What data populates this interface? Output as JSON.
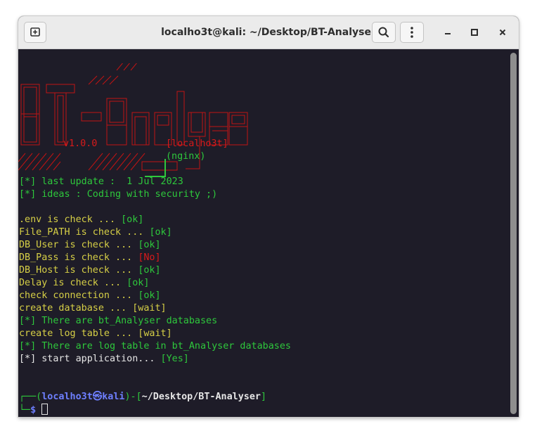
{
  "window": {
    "title": "localho3t@kali: ~/Desktop/BT-Analyser"
  },
  "banner": {
    "version": "v1.0.0",
    "author": "[localho3t]",
    "server": "(nginx)"
  },
  "info": [
    {
      "text": "[*] last update :  1 Jul 2023"
    },
    {
      "text": "[*] ideas : Coding with security ;)"
    }
  ],
  "checks": [
    {
      "text": ".env is check ... ",
      "status": "[ok]"
    },
    {
      "text": "File_PATH is check ... ",
      "status": "[ok]"
    },
    {
      "text": "DB_User is check ... ",
      "status": "[ok]"
    },
    {
      "text": "DB_Pass is check ... ",
      "status": "[No]"
    },
    {
      "text": "DB_Host is check ... ",
      "status": "[ok]"
    },
    {
      "text": "Delay is check ... ",
      "status": "[ok]"
    },
    {
      "text": "check connection ... ",
      "status": "[ok]"
    }
  ],
  "log": [
    {
      "text": "create database ... [wait]"
    },
    {
      "text": "[*] There are bt_Analyser databases"
    },
    {
      "text": "create log table ... [wait]"
    },
    {
      "text": "[*] There are log table in bt_Analyser databases"
    }
  ],
  "start": {
    "text": "[*] start application... ",
    "status": "[Yes]"
  },
  "prompt": {
    "open": "┌──(",
    "user": "localho3t",
    "at": "㉿",
    "host": "kali",
    "mid": ")-[",
    "path": "~/Desktop/BT-Analyser",
    "close": "]",
    "corner": "└─",
    "symbol": "$"
  },
  "colors": {
    "yellow": "#d6cf46",
    "green": "#2ec83c",
    "red": "#d81a1a",
    "blue": "#6e7fff",
    "bg": "#1e1c28"
  },
  "icons": [
    "new-tab-icon",
    "search-icon",
    "kebab-menu-icon",
    "minimize-icon",
    "maximize-icon",
    "close-icon"
  ]
}
